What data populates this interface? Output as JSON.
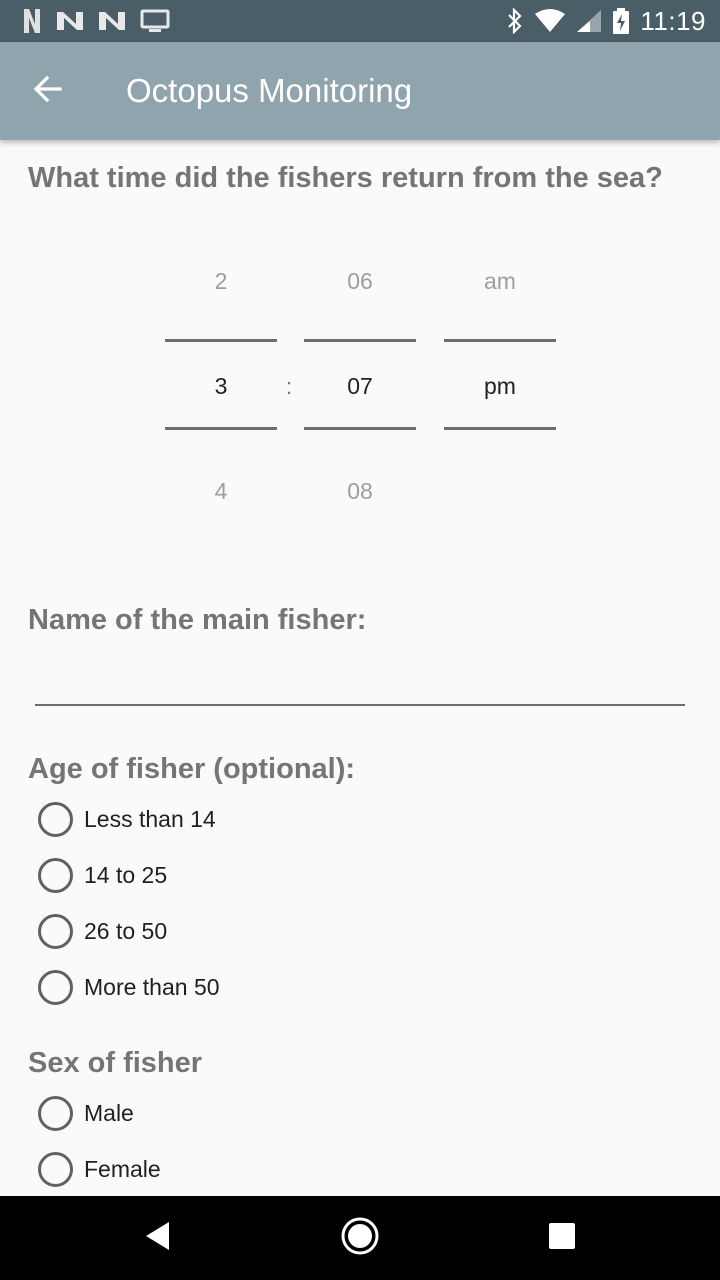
{
  "status_bar": {
    "time": "11:19",
    "left_icons": [
      "netflix-n-icon",
      "notification-n-icon",
      "notification-n-icon",
      "cast-tv-icon"
    ],
    "right_icons": [
      "bluetooth-icon",
      "wifi-icon",
      "cell-signal-icon",
      "battery-charging-icon"
    ]
  },
  "app_bar": {
    "title": "Octopus Monitoring",
    "back_icon": "arrow-back-icon",
    "color": "#90a4ae"
  },
  "questions": {
    "return_time": {
      "label": "What time did the fishers return from the sea?",
      "hour": {
        "prev": "2",
        "selected": "3",
        "next": "4"
      },
      "separator": ":",
      "minute": {
        "prev": "06",
        "selected": "07",
        "next": "08"
      },
      "ampm": {
        "prev": "am",
        "selected": "pm",
        "next": ""
      }
    },
    "main_fisher_name": {
      "label": "Name of the main fisher:",
      "value": "",
      "placeholder": ""
    },
    "age": {
      "label": "Age of fisher (optional):",
      "options": [
        "Less than 14",
        "14 to 25",
        "26 to 50",
        "More than 50"
      ]
    },
    "sex": {
      "label": "Sex of fisher",
      "options": [
        "Male",
        "Female"
      ]
    }
  },
  "nav_bar": {
    "back": "nav-back-icon",
    "home": "nav-home-icon",
    "recents": "nav-recents-icon"
  }
}
